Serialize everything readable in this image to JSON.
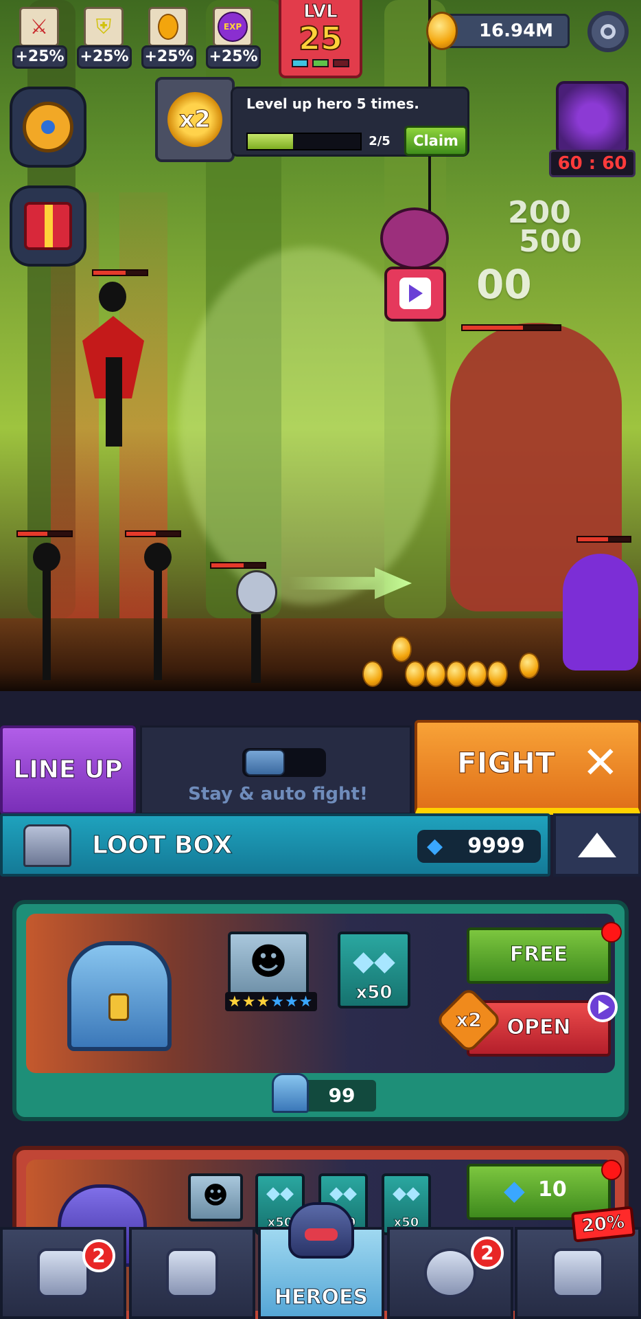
{
  "hud": {
    "boosts": [
      {
        "icon": "sword-icon",
        "value": "+25%"
      },
      {
        "icon": "shield-icon",
        "value": "+25%"
      },
      {
        "icon": "coin-icon",
        "value": "+25%"
      },
      {
        "icon": "exp-icon",
        "value": "+25%"
      }
    ],
    "level_label": "LVL",
    "level_value": "25",
    "coins": "16.94M",
    "exp_label": "EXP"
  },
  "quest": {
    "multiplier": "x2",
    "text": "Level up hero 5 times.",
    "progress_current": 2,
    "progress_total": 5,
    "progress_text": "2/5",
    "claim_label": "Claim"
  },
  "boss": {
    "timer": "60 : 60"
  },
  "damage_numbers": [
    "200",
    "500",
    "00"
  ],
  "controls": {
    "lineup_label": "LINE UP",
    "auto_fight_label": "Stay & auto fight!",
    "auto_fight_on": false,
    "fight_label": "FIGHT"
  },
  "loot": {
    "title": "LOOT BOX",
    "gems": "9999",
    "card1": {
      "hero_stars": 3,
      "hero_max_stars": 6,
      "gem_reward": "x50",
      "free_label": "FREE",
      "open_label": "OPEN",
      "multiplier": "x2",
      "chest_count": "99"
    },
    "card2": {
      "gem_rewards": [
        "x50",
        "x50",
        "x50"
      ],
      "price": "10",
      "discount": "20%"
    }
  },
  "nav": {
    "tabs": [
      {
        "name": "loot",
        "icon": "chest-icon",
        "badge": "2"
      },
      {
        "name": "upgrade",
        "icon": "upgrade-book-icon",
        "badge": ""
      },
      {
        "name": "heroes",
        "icon": "helmet-icon",
        "label": "HEROES",
        "active": true
      },
      {
        "name": "skills",
        "icon": "ring-icon",
        "badge": "2"
      },
      {
        "name": "home",
        "icon": "castle-icon",
        "badge": ""
      }
    ]
  }
}
